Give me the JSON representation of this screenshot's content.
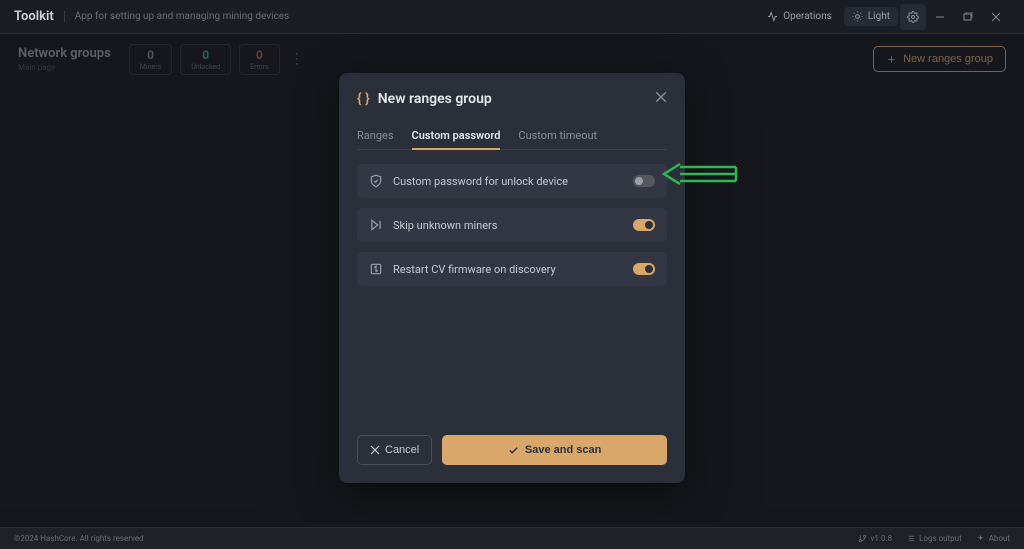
{
  "header": {
    "app_title": "Toolkit",
    "app_desc": "App for setting up and managing mining devices",
    "operations_label": "Operations",
    "light_label": "Light"
  },
  "subheader": {
    "title": "Network groups",
    "subtitle": "Main page",
    "stats": [
      {
        "value": "0",
        "label": "Miners"
      },
      {
        "value": "0",
        "label": "Unlocked"
      },
      {
        "value": "0",
        "label": "Errors"
      }
    ],
    "new_button": "New ranges group"
  },
  "modal": {
    "title": "New ranges group",
    "tabs": [
      "Ranges",
      "Custom password",
      "Custom timeout"
    ],
    "active_tab": 1,
    "options": [
      {
        "icon": "shield",
        "label": "Custom password for unlock device",
        "on": false
      },
      {
        "icon": "skip",
        "label": "Skip unknown miners",
        "on": true
      },
      {
        "icon": "restart",
        "label": "Restart CV firmware on discovery",
        "on": true
      }
    ],
    "cancel": "Cancel",
    "save": "Save and scan"
  },
  "footer": {
    "copyright": "©2024 HashCore. All rights reserved",
    "version": "v1.0.8",
    "logs": "Logs output",
    "about": "About"
  },
  "annotation_color": "#2fb84f"
}
